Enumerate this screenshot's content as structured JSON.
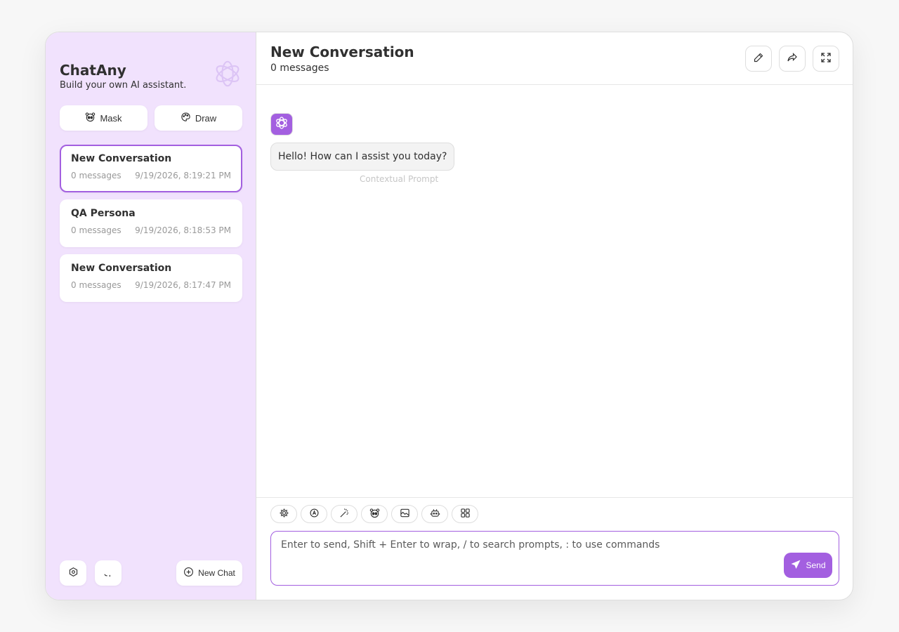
{
  "colors": {
    "accent": "#a35fe0",
    "sidebar_bg": "#f1e2fd",
    "text": "#303030",
    "muted": "#999999"
  },
  "sidebar": {
    "title": "ChatAny",
    "subtitle": "Build your own AI assistant.",
    "logo_icon": "openai-logo-icon",
    "mask_label": "Mask",
    "draw_label": "Draw",
    "sessions": [
      {
        "title": "New Conversation",
        "count": "0 messages",
        "time": "9/19/2026, 8:19:21 PM",
        "active": true
      },
      {
        "title": "QA Persona",
        "count": "0 messages",
        "time": "9/19/2026, 8:18:53 PM",
        "active": false
      },
      {
        "title": "New Conversation",
        "count": "0 messages",
        "time": "9/19/2026, 8:17:47 PM",
        "active": false
      }
    ],
    "new_chat_label": "New Chat",
    "bottom_icons": [
      "settings-icon",
      "github-icon"
    ]
  },
  "header": {
    "title": "New Conversation",
    "subtitle": "0 messages",
    "buttons": [
      "edit-icon",
      "share-icon",
      "fullscreen-icon"
    ]
  },
  "messages": [
    {
      "role": "assistant",
      "text": "Hello! How can I assist you today?",
      "note": "Contextual Prompt"
    }
  ],
  "input": {
    "placeholder": "Enter to send, Shift + Enter to wrap, / to search prompts, : to use commands",
    "value": "",
    "send_label": "Send",
    "action_icons": [
      "settings-icon",
      "theme-icon",
      "magic-wand-icon",
      "mask-icon",
      "image-icon",
      "robot-icon",
      "grid-icon"
    ]
  }
}
